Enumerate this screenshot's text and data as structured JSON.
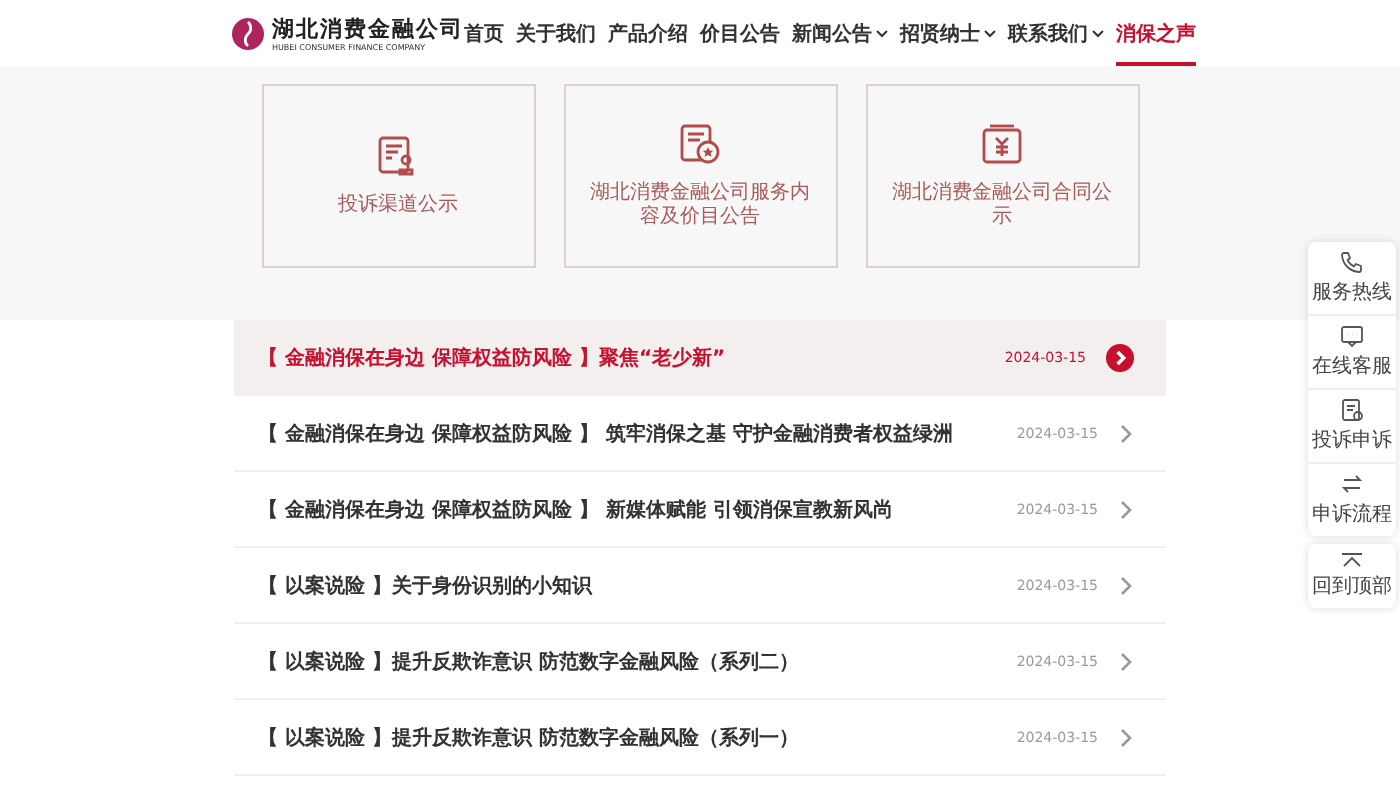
{
  "header": {
    "logo": {
      "name": "湖北消费金融公司",
      "subtitle": "HUBEI CONSUMER FINANCE COMPANY"
    },
    "nav": [
      {
        "label": "首页",
        "selected": false,
        "dropdown": false
      },
      {
        "label": "关于我们",
        "selected": false,
        "dropdown": false
      },
      {
        "label": "产品介绍",
        "selected": false,
        "dropdown": false
      },
      {
        "label": "价目公告",
        "selected": false,
        "dropdown": false
      },
      {
        "label": "新闻公告",
        "selected": false,
        "dropdown": true
      },
      {
        "label": "招贤纳士",
        "selected": false,
        "dropdown": true
      },
      {
        "label": "联系我们",
        "selected": false,
        "dropdown": true
      },
      {
        "label": "消保之声",
        "selected": true,
        "dropdown": false
      }
    ]
  },
  "cards": [
    {
      "kind": "stamp",
      "label": "投诉渠道公示"
    },
    {
      "kind": "badge",
      "label": "湖北消费金融公司服务内容及价目公告"
    },
    {
      "kind": "yuan",
      "label": "湖北消费金融公司合同公示"
    }
  ],
  "articles": [
    {
      "title": "【 金融消保在身边 保障权益防风险 】聚焦“老少新”",
      "date": "2024-03-15",
      "selected": true
    },
    {
      "title": "【 金融消保在身边 保障权益防风险 】 筑牢消保之基 守护金融消费者权益绿洲",
      "date": "2024-03-15",
      "selected": false
    },
    {
      "title": "【 金融消保在身边 保障权益防风险 】 新媒体赋能 引领消保宣教新风尚",
      "date": "2024-03-15",
      "selected": false
    },
    {
      "title": "【 以案说险 】关于身份识别的小知识",
      "date": "2024-03-15",
      "selected": false
    },
    {
      "title": "【 以案说险 】提升反欺诈意识 防范数字金融风险（系列二）",
      "date": "2024-03-15",
      "selected": false
    },
    {
      "title": "【 以案说险 】提升反欺诈意识 防范数字金融风险（系列一）",
      "date": "2024-03-15",
      "selected": false
    }
  ],
  "sidebar": [
    {
      "kind": "phone",
      "label": "服务热线"
    },
    {
      "kind": "chat",
      "label": "在线客服"
    },
    {
      "kind": "complaint",
      "label": "投诉申诉"
    },
    {
      "kind": "flow",
      "label": "申诉流程"
    }
  ],
  "back_to_top": {
    "label": "回到顶部"
  }
}
